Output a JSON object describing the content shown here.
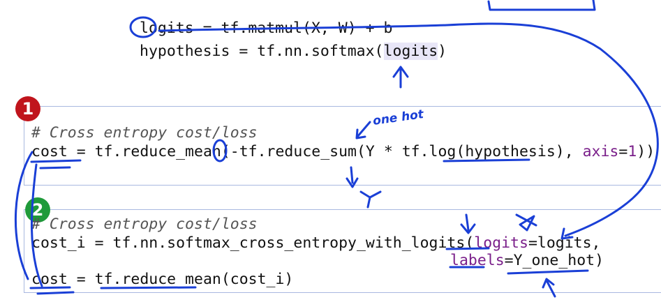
{
  "top_code": {
    "line1_var": "logits",
    "line1_rest": " = tf.matmul(X, W) + b",
    "line2_pre": "hypothesis = tf.nn.softmax(",
    "line2_hl": "logits",
    "line2_post": ")"
  },
  "cell1": {
    "badge": "1",
    "badge_color": "#c0141c",
    "comment": "# Cross entropy cost/loss",
    "line_pre": "cost = tf.reduce_mean(-tf.reduce_sum(Y * tf.log(hypothesis), ",
    "line_kw": "axis",
    "line_eq": "=",
    "line_num": "1",
    "line_post": "))"
  },
  "cell2": {
    "badge": "2",
    "badge_color": "#1f9a3a",
    "comment": "# Cross entropy cost/loss",
    "line1_pre": "cost_i = tf.nn.softmax_cross_entropy_with_logits(",
    "line1_kw": "logits",
    "line1_post": "=logits,",
    "line2_kw": "labels",
    "line2_post": "=Y_one_hot)",
    "line3": "cost = tf.reduce_mean(cost_i)"
  },
  "annotations": {
    "one_hot": "one hot",
    "y_label": "Y"
  },
  "colors": {
    "ink": "#1a3fd6",
    "keyword": "#7a1f8a",
    "highlight": "#e8e6f7"
  }
}
